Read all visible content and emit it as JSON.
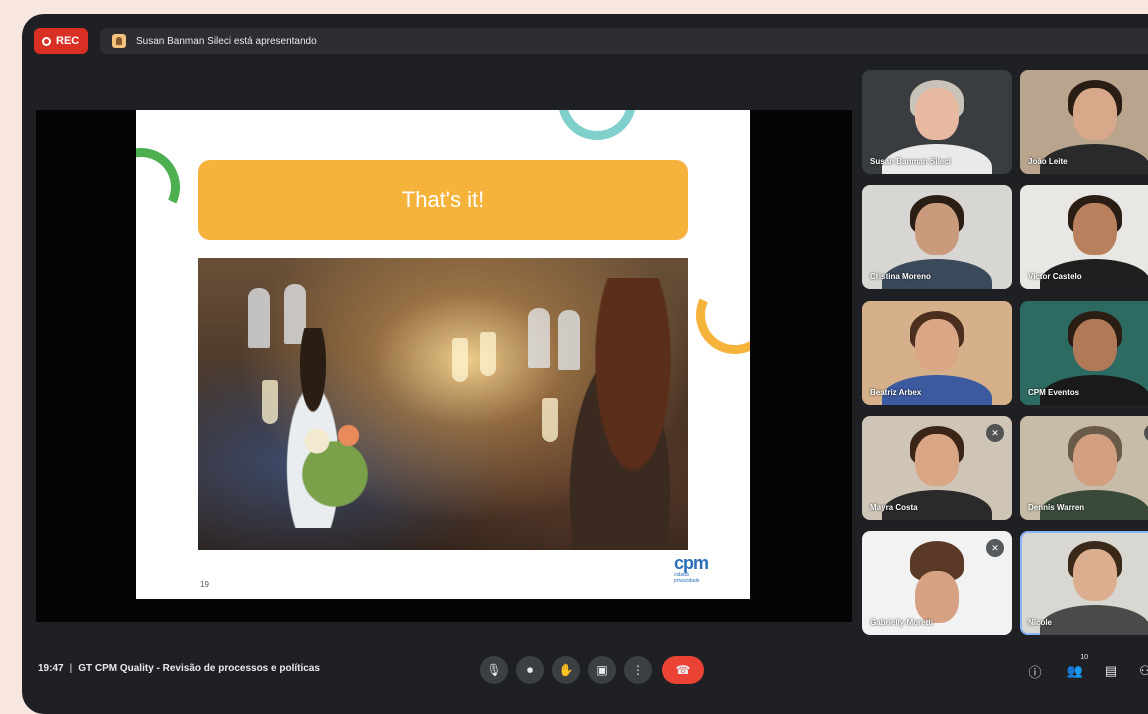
{
  "recording": {
    "label": "REC",
    "color": "#d93025"
  },
  "presenter_banner": {
    "text": "Susan Banman Sileci está apresentando"
  },
  "slide": {
    "title": "That's it!",
    "page_number": "19",
    "logo_text": "cpm",
    "logo_subtext": "cidadã\nprivacidade",
    "colors": {
      "banner": "#f6b33b",
      "teal": "#7fcfca",
      "green": "#4caf50"
    }
  },
  "participants": [
    {
      "name": "Susan Banman Sileci"
    },
    {
      "name": "João Leite"
    },
    {
      "name": "Cristina Moreno"
    },
    {
      "name": "Victor Castelo"
    },
    {
      "name": "Beatriz Arbex"
    },
    {
      "name": "CPM Eventos"
    },
    {
      "name": "Mayra Costa",
      "muted": true
    },
    {
      "name": "Dennis Warren",
      "muted": true
    },
    {
      "name": "Gabrielly Moretti",
      "muted": true
    },
    {
      "name": "Nicole",
      "speaking": true
    }
  ],
  "bottom_bar": {
    "time": "19:47",
    "meeting_title": "GT CPM Quality - Revisão de processos e políticas",
    "participant_count": "10",
    "controls": {
      "mic": "mic-icon",
      "camera": "camera-icon",
      "raise_hand": "raise-hand-icon",
      "present": "present-screen-icon",
      "more": "more-options-icon",
      "hangup": "hangup-icon"
    },
    "right_controls": [
      "info-icon",
      "people-icon",
      "chat-icon",
      "activities-icon"
    ],
    "hangup_color": "#ea4335"
  }
}
